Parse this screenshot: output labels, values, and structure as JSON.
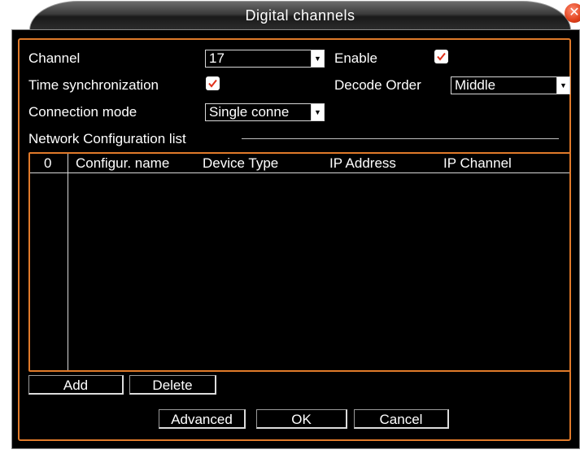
{
  "window": {
    "title": "Digital channels",
    "close_symbol": "✕"
  },
  "form": {
    "channel_label": "Channel",
    "channel_value": "17",
    "enable_label": "Enable",
    "enable_checked": true,
    "time_sync_label": "Time synchronization",
    "time_sync_checked": true,
    "decode_order_label": "Decode Order",
    "decode_order_value": "Middle",
    "connection_mode_label": "Connection mode",
    "connection_mode_value": "Single conne"
  },
  "network_list": {
    "group_label": "Network Configuration list",
    "columns": [
      "0",
      "Configur. name",
      "Device Type",
      "IP Address",
      "IP Channel"
    ],
    "rows": []
  },
  "buttons": {
    "add": "Add",
    "delete": "Delete",
    "advanced": "Advanced",
    "ok": "OK",
    "cancel": "Cancel"
  },
  "colors": {
    "accent_border": "#e07a2a",
    "close_button": "#e0401a",
    "checkmark": "#e0301a"
  }
}
